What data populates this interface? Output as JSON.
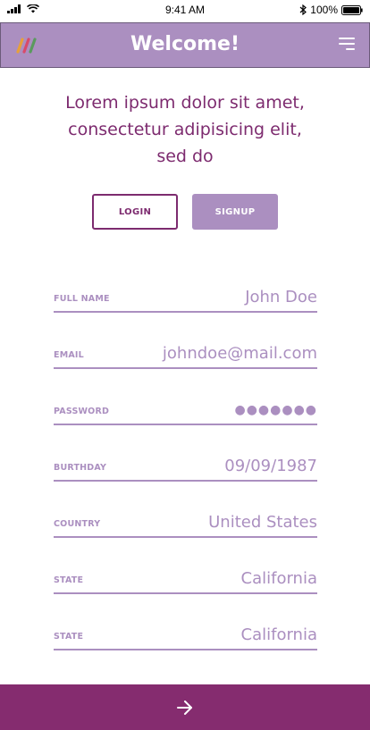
{
  "status_bar": {
    "time": "9:41 AM",
    "battery": "100%",
    "icons": [
      "signal-icon",
      "wifi-icon",
      "bluetooth-icon",
      "battery-icon"
    ]
  },
  "header": {
    "title": "Welcome!",
    "logo_icon": "colorful-stripes-logo-icon",
    "menu_icon": "hamburger-menu-icon"
  },
  "intro": {
    "text": "Lorem ipsum dolor sit amet, consectetur adipisicing elit, sed do"
  },
  "auth_tabs": {
    "login_label": "LOGIN",
    "signup_label": "SIGNUP"
  },
  "form": {
    "fields": [
      {
        "label": "FULL NAME",
        "value": "John Doe"
      },
      {
        "label": "EMAIL",
        "value": "johndoe@mail.com"
      },
      {
        "label": "PASSWORD",
        "value": "●●●●●●●"
      },
      {
        "label": "BURTHDAY",
        "value": "09/09/1987"
      },
      {
        "label": "COUNTRY",
        "value": "United States"
      },
      {
        "label": "STATE",
        "value": "California"
      },
      {
        "label": "STATE",
        "value": "California"
      }
    ]
  },
  "footer": {
    "next_icon": "arrow-right-icon"
  },
  "colors": {
    "header_bg": "#ab8fc0",
    "accent_dark": "#852c6f",
    "text_accent": "#7d2b6f",
    "field_color": "#ab8fc0"
  }
}
